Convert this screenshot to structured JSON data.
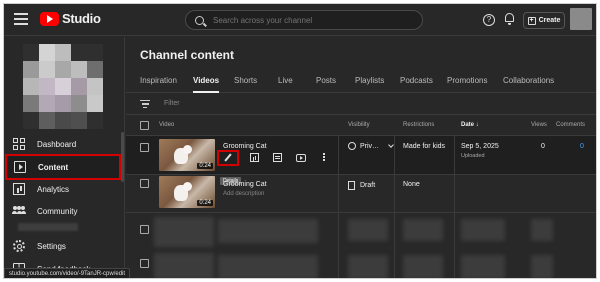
{
  "header": {
    "logo_text": "Studio",
    "search_placeholder": "Search across your channel",
    "help_glyph": "?",
    "create_label": "Create",
    "create_glyph": "+"
  },
  "sidebar": {
    "items": [
      {
        "label": "Dashboard",
        "icon": "dashboard-icon"
      },
      {
        "label": "Content",
        "icon": "content-icon",
        "active": true
      },
      {
        "label": "Analytics",
        "icon": "analytics-icon"
      },
      {
        "label": "Community",
        "icon": "community-icon"
      },
      {
        "label": "Settings",
        "icon": "gear-icon"
      },
      {
        "label": "Send feedback",
        "icon": "feedback-icon",
        "glyph": "!"
      }
    ]
  },
  "main": {
    "title": "Channel content",
    "tabs": [
      "Inspiration",
      "Videos",
      "Shorts",
      "Live",
      "Posts",
      "Playlists",
      "Podcasts",
      "Promotions",
      "Collaborations"
    ],
    "active_tab": "Videos",
    "filter_placeholder": "Filter",
    "columns": {
      "video": "Video",
      "visibility": "Visibility",
      "restrictions": "Restrictions",
      "date": "Date ↓",
      "views": "Views",
      "comments": "Comments"
    },
    "rows": [
      {
        "title": "Grooming Cat",
        "duration": "0:24",
        "visibility": "Priv…",
        "restrictions": "Made for kids",
        "date": "Sep 5, 2025",
        "date_status": "Uploaded",
        "views": "0",
        "comments": "0"
      },
      {
        "title": "Grooming Cat",
        "duration": "0:24",
        "description": "Add description",
        "visibility": "Draft",
        "restrictions": "None"
      }
    ],
    "tooltip": "Details"
  },
  "status_url": "studio.youtube.com/video/-9TanJR-cpw/edit",
  "colors": {
    "background": "#282828",
    "accent_red": "#ff0000",
    "highlight_outline": "#d40000",
    "link_blue": "#3ea6ff"
  }
}
